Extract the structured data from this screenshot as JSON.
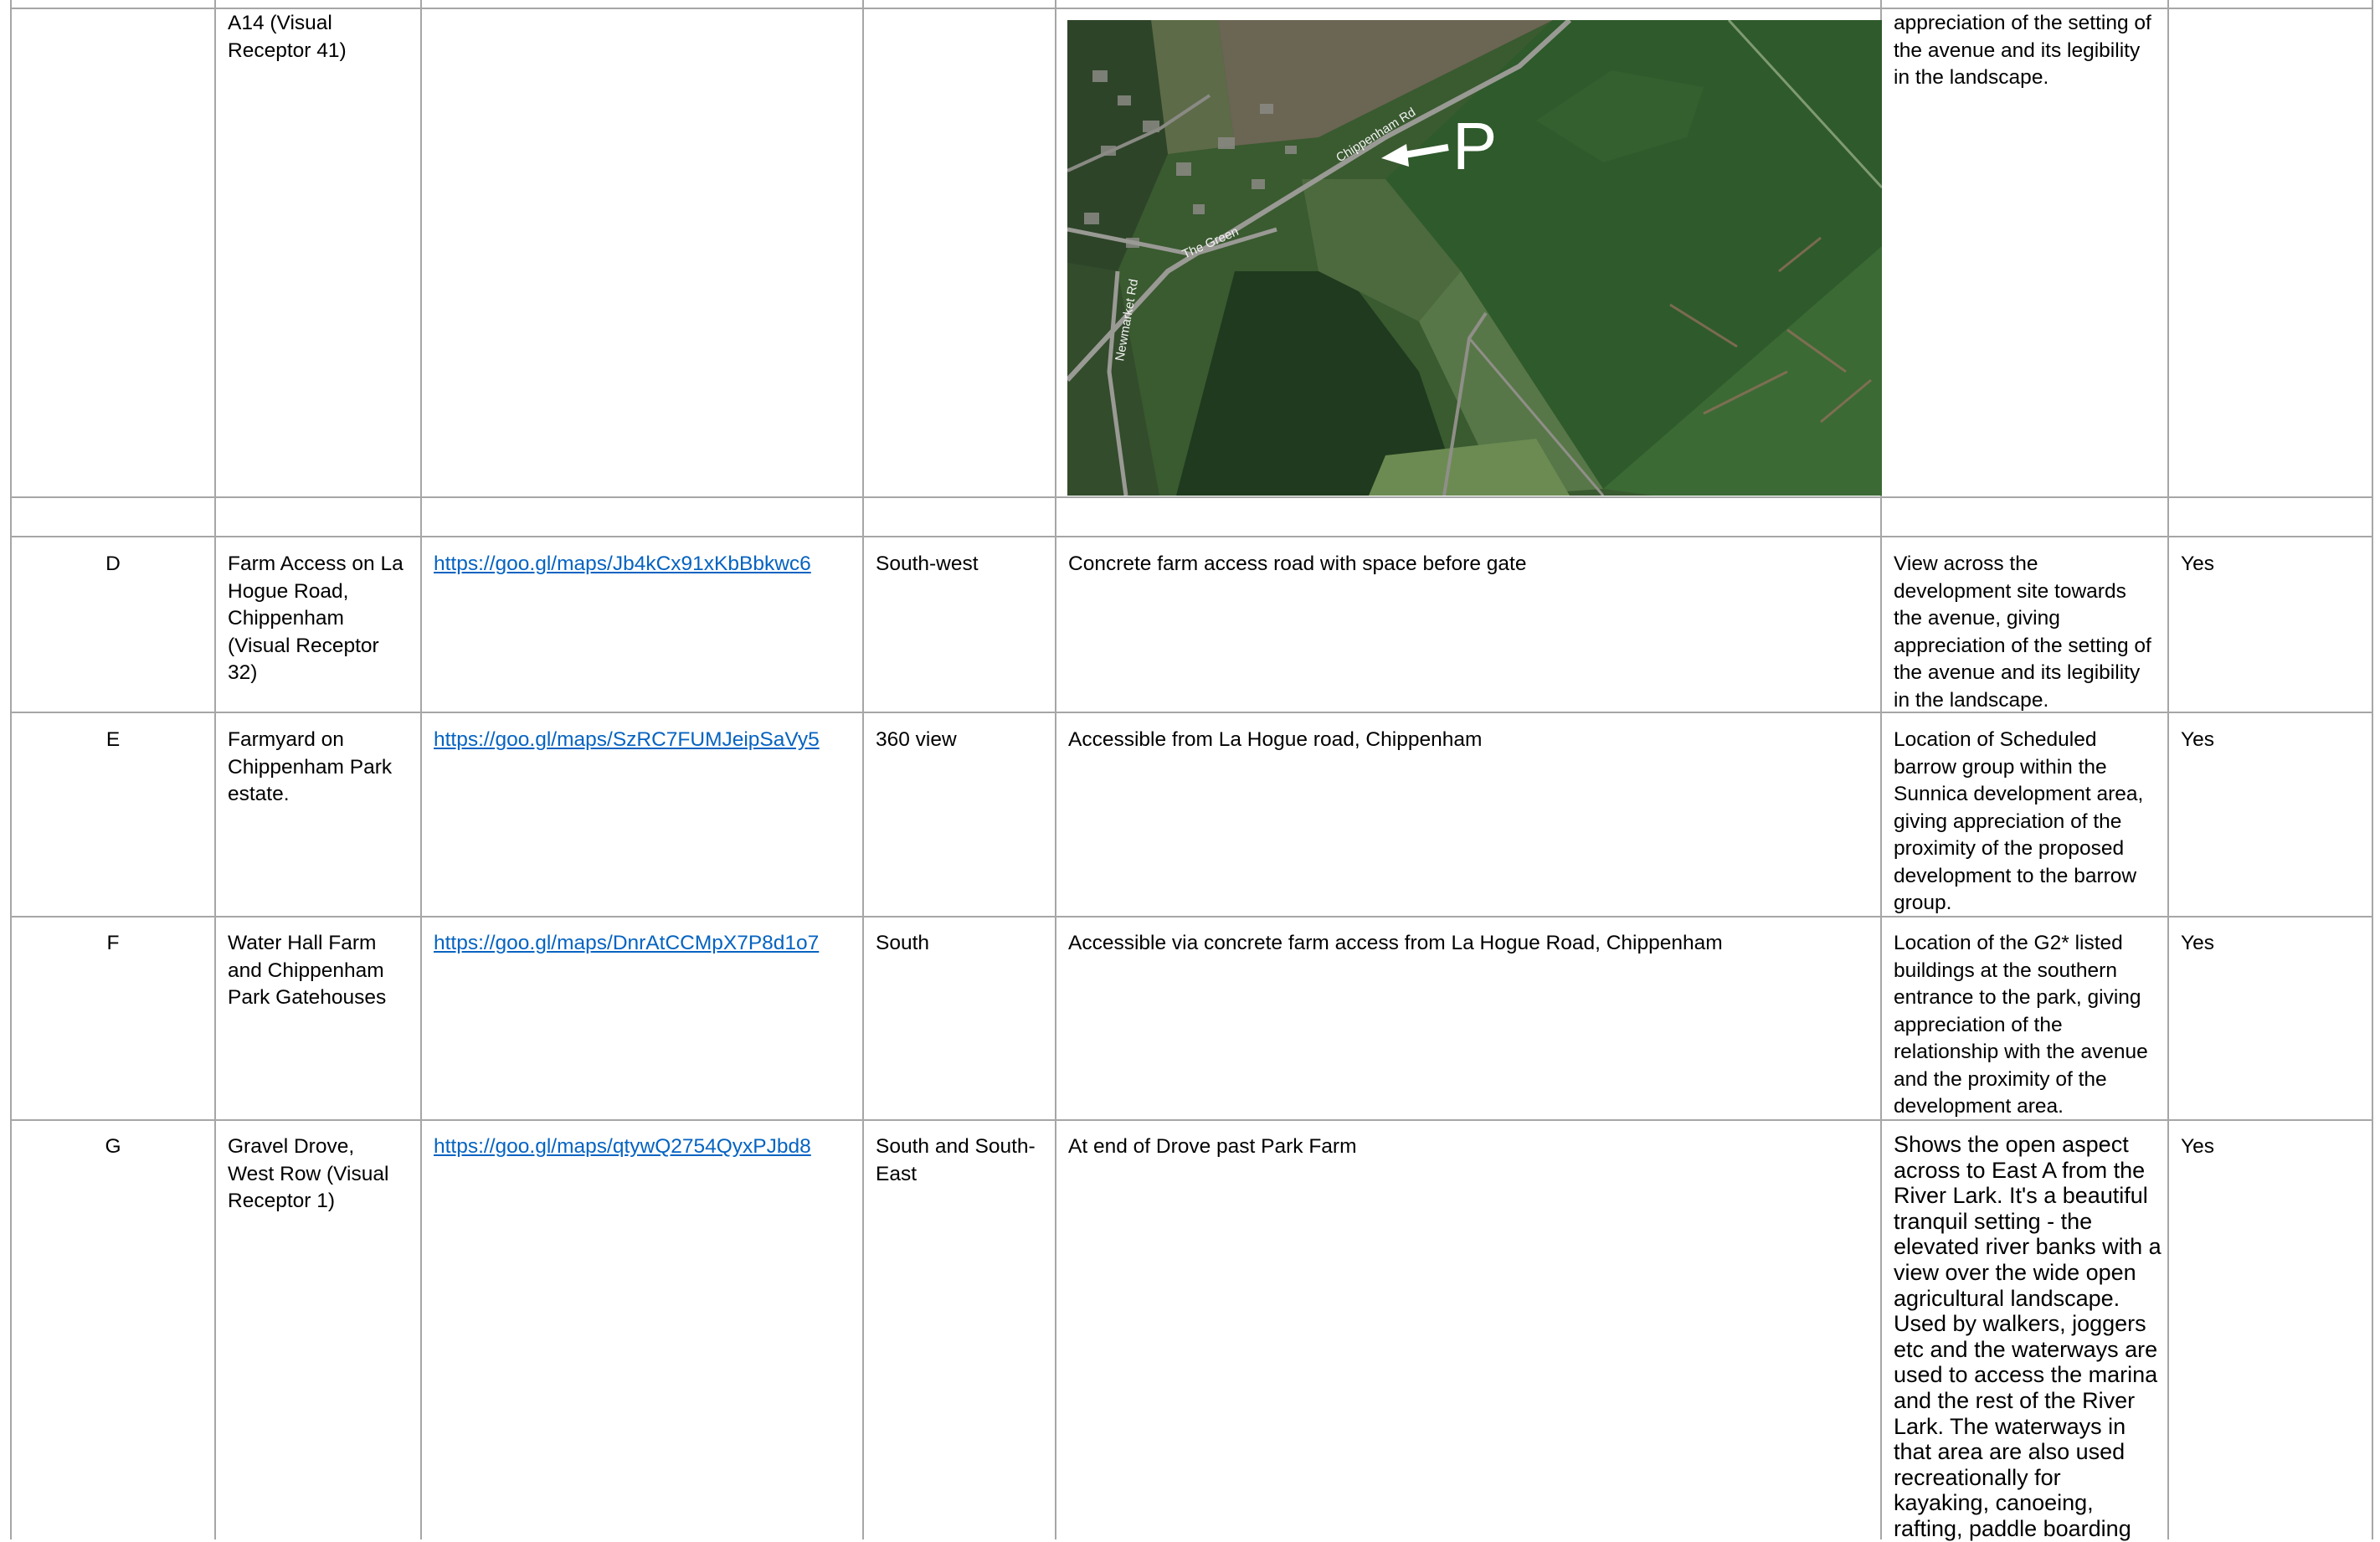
{
  "table": {
    "top_row": {
      "location": "A14 (Visual Receptor 41)",
      "reason": "appreciation of the setting of the avenue and its legibility in the landscape.",
      "map": {
        "road_labels": [
          "Chippenham Rd",
          "The Green",
          "Newmarket Rd"
        ],
        "marker_label": "P"
      }
    },
    "rows": [
      {
        "ref": "D",
        "location": "Farm Access on La Hogue Road, Chippenham (Visual Receptor 32)",
        "link": "https://goo.gl/maps/Jb4kCx91xKbBbkwc6",
        "direction": "South-west",
        "access": "Concrete farm access road with space before gate",
        "reason": "View across the development site towards the avenue, giving appreciation of the setting of the avenue and its legibility in the landscape.",
        "included": "Yes"
      },
      {
        "ref": "E",
        "location": "Farmyard on Chippenham Park estate.",
        "link": "https://goo.gl/maps/SzRC7FUMJeipSaVy5",
        "direction": "360 view",
        "access": "Accessible from La Hogue road, Chippenham",
        "reason": "Location of Scheduled barrow group within the Sunnica development area, giving appreciation of the proximity of the proposed development to the barrow group.",
        "included": "Yes"
      },
      {
        "ref": "F",
        "location": "Water Hall Farm and Chippenham Park Gatehouses",
        "link": "https://goo.gl/maps/DnrAtCCMpX7P8d1o7",
        "direction": "South",
        "access": "Accessible via concrete farm access from La Hogue Road, Chippenham",
        "reason": "Location of the G2* listed buildings at the southern entrance to the park, giving appreciation of the relationship with the avenue and the proximity of the development area.",
        "included": "Yes"
      },
      {
        "ref": "G",
        "location": "Gravel Drove, West Row (Visual Receptor 1)",
        "link": "https://goo.gl/maps/qtywQ2754QyxPJbd8",
        "direction": "South and South-East",
        "access": "At end of Drove past Park Farm",
        "reason": "Shows the open aspect across to East A from the River Lark. It's a beautiful tranquil setting - the elevated river banks with a view over the wide open agricultural landscape. Used by walkers, joggers etc and the waterways are used to access the marina and the rest of the River Lark. The waterways in that area are also used recreationally for kayaking, canoeing, rafting, paddle boarding",
        "included": "Yes"
      }
    ]
  }
}
